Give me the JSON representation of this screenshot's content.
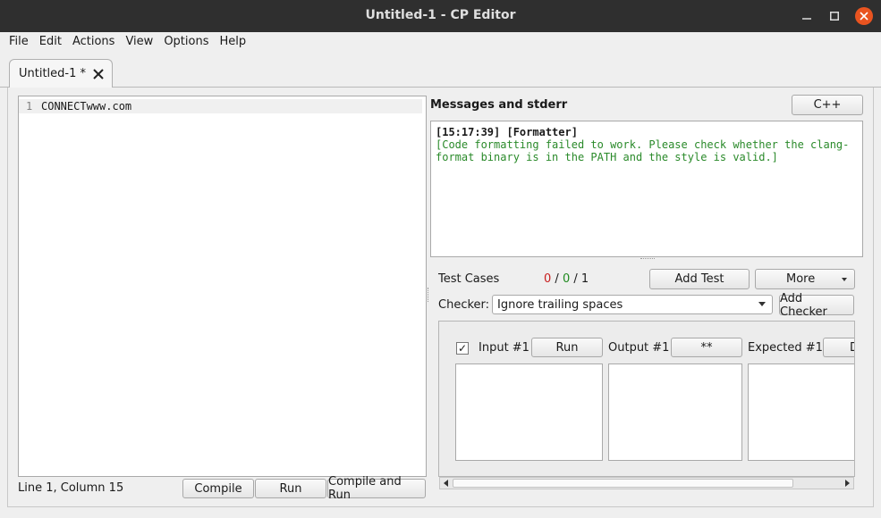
{
  "window": {
    "title": "Untitled-1 - CP Editor",
    "minimize_glyph": "—",
    "maximize_glyph": "☐",
    "close_glyph": "✕"
  },
  "menu": [
    "File",
    "Edit",
    "Actions",
    "View",
    "Options",
    "Help"
  ],
  "tab": {
    "label": "Untitled-1 *",
    "close_icon": "tab-close-icon"
  },
  "editor": {
    "line_number": "1",
    "code": "CONNECTwww.com",
    "status": "Line 1, Column 15",
    "compile_label": "Compile",
    "run_label": "Run",
    "compile_run_label": "Compile and Run"
  },
  "messages": {
    "title": "Messages and stderr",
    "language_button": "C++",
    "entry_header": "[15:17:39] [Formatter]",
    "entry_body": "[Code formatting failed to work. Please check whether the clang-format binary is in the PATH and the style is valid.]"
  },
  "tests": {
    "label": "Test Cases",
    "passed": "0",
    "total_run": "0",
    "total": "1",
    "separator": " / ",
    "add_test_label": "Add Test",
    "more_label": "More",
    "checker_label": "Checker:",
    "checker_value": "Ignore trailing spaces",
    "add_checker_label": "Add Checker",
    "case": {
      "checked": "✓",
      "input_label": "Input #1",
      "run_label": "Run",
      "output_label": "Output #1",
      "output_button": "**",
      "expected_label": "Expected #1",
      "expected_button": "D"
    }
  },
  "colors": {
    "titlebar": "#2f2f2f",
    "accent_close": "#e95420",
    "message_text": "#2a8a2a",
    "fail_count": "#c81e1e",
    "pass_count": "#1f8a1f"
  }
}
